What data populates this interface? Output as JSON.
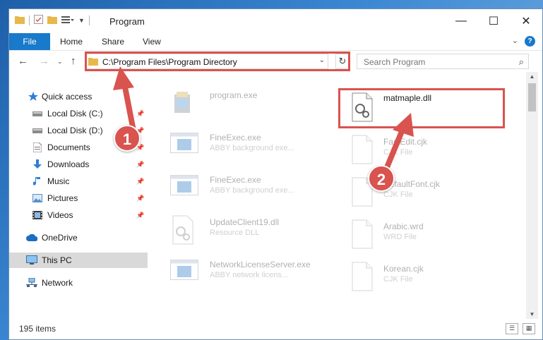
{
  "window": {
    "title": "Program"
  },
  "ribbon": {
    "file": "File",
    "tabs": [
      "Home",
      "Share",
      "View"
    ]
  },
  "address": {
    "path": "C:\\Program Files\\Program Directory"
  },
  "search": {
    "placeholder": "Search Program"
  },
  "nav": {
    "items": [
      {
        "label": "Quick access",
        "icon": "star-icon",
        "pinned": false
      },
      {
        "label": "Local Disk (C:)",
        "icon": "drive-icon",
        "pinned": true
      },
      {
        "label": "Local Disk (D:)",
        "icon": "drive-icon",
        "pinned": true
      },
      {
        "label": "Documents",
        "icon": "documents-icon",
        "pinned": true
      },
      {
        "label": "Downloads",
        "icon": "download-icon",
        "pinned": true
      },
      {
        "label": "Music",
        "icon": "music-icon",
        "pinned": true
      },
      {
        "label": "Pictures",
        "icon": "pictures-icon",
        "pinned": true
      },
      {
        "label": "Videos",
        "icon": "videos-icon",
        "pinned": true
      },
      {
        "label": "OneDrive",
        "icon": "cloud-icon",
        "pinned": false
      },
      {
        "label": "This PC",
        "icon": "computer-icon",
        "pinned": false,
        "selected": true
      },
      {
        "label": "Network",
        "icon": "network-icon",
        "pinned": false
      }
    ]
  },
  "files": {
    "left": [
      {
        "name": "program.exe",
        "desc": ""
      },
      {
        "name": "FineExec.exe",
        "desc": "ABBY background exe..."
      },
      {
        "name": "FineExec.exe",
        "desc": "ABBY background exe..."
      },
      {
        "name": "UpdateClient19.dll",
        "desc": "Resource DLL"
      },
      {
        "name": "NetworkLicenseServer.exe",
        "desc": "ABBY network licens..."
      }
    ],
    "right": [
      {
        "name": "matmaple.dll",
        "desc": "",
        "highlighted": true
      },
      {
        "name": "FastEdit.cjk",
        "desc": "CJK File"
      },
      {
        "name": "DefaultFont.cjk",
        "desc": "CJK File"
      },
      {
        "name": "Arabic.wrd",
        "desc": "WRD File"
      },
      {
        "name": "Korean.cjk",
        "desc": "CJK File"
      }
    ]
  },
  "status": {
    "count": "195 items"
  },
  "callouts": {
    "one": "1",
    "two": "2"
  },
  "colors": {
    "accent": "#1979ca",
    "highlight": "#d9534f"
  }
}
